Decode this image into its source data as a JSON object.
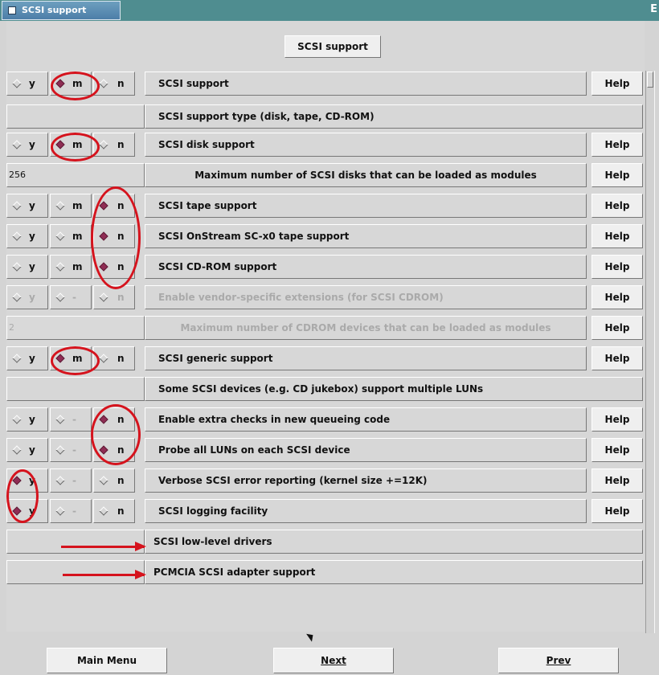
{
  "window": {
    "title": "SCSI support",
    "header_button": "SCSI support"
  },
  "help_label": "Help",
  "rows": [
    {
      "kind": "tristate",
      "label": "SCSI support",
      "choices": [
        "y",
        "m",
        "n"
      ],
      "selected": "m",
      "disabled": false
    },
    {
      "kind": "section",
      "label": "SCSI support type (disk, tape, CD-ROM)"
    },
    {
      "kind": "tristate",
      "label": "SCSI disk support",
      "choices": [
        "y",
        "m",
        "n"
      ],
      "selected": "m",
      "disabled": false
    },
    {
      "kind": "value",
      "label": "Maximum number of SCSI disks that can be loaded as modules",
      "value": "256",
      "disabled": false
    },
    {
      "kind": "tristate",
      "label": "SCSI tape support",
      "choices": [
        "y",
        "m",
        "n"
      ],
      "selected": "n",
      "disabled": false
    },
    {
      "kind": "tristate",
      "label": "SCSI OnStream SC-x0 tape support",
      "choices": [
        "y",
        "m",
        "n"
      ],
      "selected": "n",
      "disabled": false
    },
    {
      "kind": "tristate",
      "label": "SCSI CD-ROM support",
      "choices": [
        "y",
        "m",
        "n"
      ],
      "selected": "n",
      "disabled": false
    },
    {
      "kind": "tristate",
      "label": "Enable vendor-specific extensions (for SCSI CDROM)",
      "choices": [
        "y",
        "-",
        "n"
      ],
      "selected": "",
      "disabled": true
    },
    {
      "kind": "value",
      "label": "Maximum number of CDROM devices that can be loaded as modules",
      "value": "2",
      "disabled": true
    },
    {
      "kind": "tristate",
      "label": "SCSI generic support",
      "choices": [
        "y",
        "m",
        "n"
      ],
      "selected": "m",
      "disabled": false
    },
    {
      "kind": "section",
      "label": "Some SCSI devices (e.g. CD jukebox) support multiple LUNs"
    },
    {
      "kind": "tristate",
      "label": "Enable extra checks in new queueing code",
      "choices": [
        "y",
        "-",
        "n"
      ],
      "selected": "n",
      "disabled": false
    },
    {
      "kind": "tristate",
      "label": "Probe all LUNs on each SCSI device",
      "choices": [
        "y",
        "-",
        "n"
      ],
      "selected": "n",
      "disabled": false
    },
    {
      "kind": "tristate",
      "label": "Verbose SCSI error reporting (kernel size +=12K)",
      "choices": [
        "y",
        "-",
        "n"
      ],
      "selected": "y",
      "disabled": false
    },
    {
      "kind": "tristate",
      "label": "SCSI logging facility",
      "choices": [
        "y",
        "-",
        "n"
      ],
      "selected": "y",
      "disabled": false
    },
    {
      "kind": "submenu",
      "label": "SCSI low-level drivers"
    },
    {
      "kind": "submenu",
      "label": "PCMCIA SCSI adapter support"
    }
  ],
  "footer": {
    "main_menu": "Main Menu",
    "next": "Next",
    "prev": "Prev"
  }
}
